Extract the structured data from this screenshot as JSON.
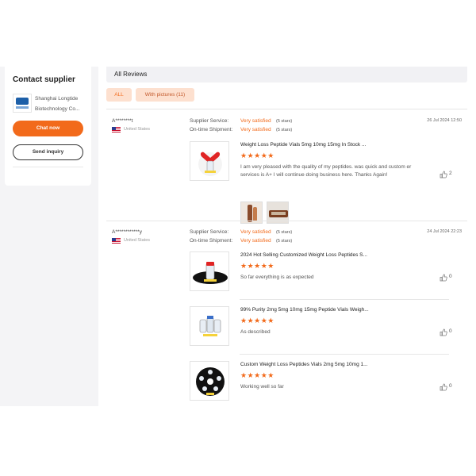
{
  "sidebar": {
    "title": "Contact supplier",
    "company_name": "Shanghai Longtide Biotechnology Co...",
    "chat_label": "Chat now",
    "inquiry_label": "Send inquiry"
  },
  "reviews_header": {
    "title": "All Reviews"
  },
  "filters": {
    "all_label": "ALL",
    "pictures_label": "With pictures (11)"
  },
  "meta_labels": {
    "supplier_service": "Supplier Service:",
    "shipment": "On-time Shipment:"
  },
  "reviews": [
    {
      "user": "A********t",
      "country": "United States",
      "supplier_service": "Very satisfied",
      "supplier_stars": "(5 stars)",
      "shipment": "Very satisfied",
      "shipment_stars": "(5 stars)",
      "date": "26 Jul 2024 12:50",
      "products": [
        {
          "title": "Weight Loss Peptide Vials 5mg 10mg 15mg In Stock ...",
          "stars": "★★★★★",
          "text": "I am very pleased with the quality of my peptides.  was quick and custom er services is A+ I will continue doing business here. Thanks Again!",
          "likes": "2"
        }
      ]
    },
    {
      "user": "A************y",
      "country": "United States",
      "supplier_service": "Very satisfied",
      "supplier_stars": "(5 stars)",
      "shipment": "Very satisfied",
      "shipment_stars": "(5 stars)",
      "date": "24 Jul 2024 22:23",
      "products": [
        {
          "title": "2024 Hot Selling Customized Weight Loss Peptides S...",
          "stars": "★★★★★",
          "text": "So far everything is as expected",
          "likes": "0"
        },
        {
          "title": "99% Purity 2mg 5mg 10mg 15mg Peptide Vials Weigh...",
          "stars": "★★★★★",
          "text": "As described",
          "likes": "0"
        },
        {
          "title": "Custom Weight Loss Peptides Vials 2mg 5mg 10mg 1...",
          "stars": "★★★★★",
          "text": "Working well so far",
          "likes": "0"
        }
      ]
    }
  ],
  "icons": {
    "like": "thumbs-up-icon",
    "flag": "us-flag-icon",
    "logo": "company-logo-icon"
  },
  "colors": {
    "accent": "#f26a1b",
    "filter_bg": "#fde0cf",
    "panel_bg": "#f4f4f6"
  }
}
